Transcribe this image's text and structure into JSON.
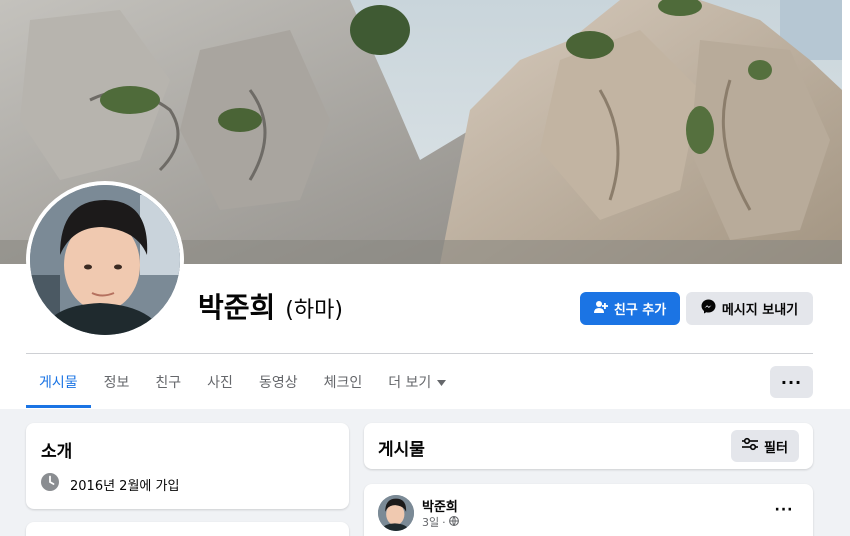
{
  "profile": {
    "name": "박준희",
    "nickname": "(하마)"
  },
  "actions": {
    "add_friend_label": "친구 추가",
    "message_label": "메시지 보내기",
    "more_label": "···"
  },
  "tabs": [
    {
      "label": "게시물",
      "active": true
    },
    {
      "label": "정보"
    },
    {
      "label": "친구"
    },
    {
      "label": "사진"
    },
    {
      "label": "동영상"
    },
    {
      "label": "체크인"
    },
    {
      "label": "더 보기"
    }
  ],
  "intro": {
    "title": "소개",
    "joined": "2016년 2월에 가입"
  },
  "posts": {
    "title": "게시물",
    "filter_label": "필터",
    "items": [
      {
        "author": "박준희",
        "time": "3일",
        "menu": "···"
      }
    ]
  },
  "colors": {
    "accent": "#1b74e4",
    "secondary_button": "#e4e6eb",
    "page_bg": "#f0f2f5"
  }
}
